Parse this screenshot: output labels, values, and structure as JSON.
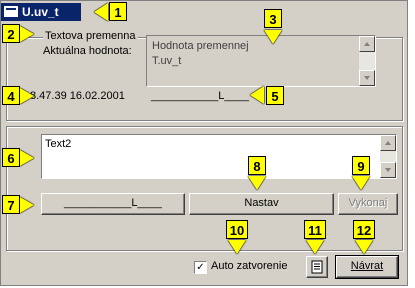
{
  "window": {
    "title": "U.uv_t"
  },
  "labels": {
    "var_type": "Textova premenna",
    "current_value": "Aktuálna hodnota:",
    "timestamp": "8.47.39 16.02.2001",
    "value_field": "___________L____"
  },
  "value_box": {
    "line1": "Hodnota premennej",
    "line2": "T.uv_t"
  },
  "input": {
    "value": "Text2"
  },
  "buttons": {
    "left_field": "___________L____",
    "set": "Nastav",
    "execute": "Vykonaj",
    "return": "Návrat"
  },
  "auto_close": {
    "label": "Auto zatvorenie",
    "checked": true
  },
  "callouts": [
    "1",
    "2",
    "3",
    "4",
    "5",
    "6",
    "7",
    "8",
    "9",
    "10",
    "11",
    "12"
  ],
  "colors": {
    "callout": "#ffff00",
    "titlebar": "#0a246a",
    "window": "#d4d0c8"
  }
}
